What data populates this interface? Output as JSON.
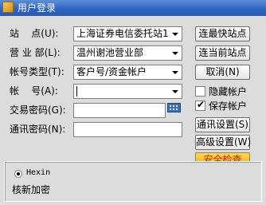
{
  "window": {
    "title": "用户登录"
  },
  "form": {
    "site": {
      "label": "站    点(U):",
      "value": "上海证券电信委托站1"
    },
    "branch": {
      "label": "营 业 部(L):",
      "value": "温州谢池营业部"
    },
    "account_type": {
      "label": "帐号类型(T):",
      "value": "客户号/资金帐户"
    },
    "account": {
      "label": "帐    号(A):",
      "value": ""
    },
    "trade_password": {
      "label": "交易密码(G):",
      "value": ""
    },
    "comm_password": {
      "label": "通讯密码(N):",
      "value": ""
    }
  },
  "buttons": {
    "fastest_site": "连最快站点",
    "current_site": "连当前站点",
    "cancel": "取消(N)",
    "comm_settings": "通讯设置(S)",
    "advanced_settings": "高级设置(W)",
    "security_check": "安全检查"
  },
  "options": {
    "hide_account": {
      "label": "隐藏帐户",
      "checked": false
    },
    "save_account": {
      "label": "保存帐户",
      "checked": true
    }
  },
  "auth": {
    "option_label": "Hexin",
    "verify_text": "核新加密"
  },
  "colors": {
    "titlebar": "#2f64c1",
    "security_button": "#f3a619",
    "security_text": "#d21b12"
  }
}
